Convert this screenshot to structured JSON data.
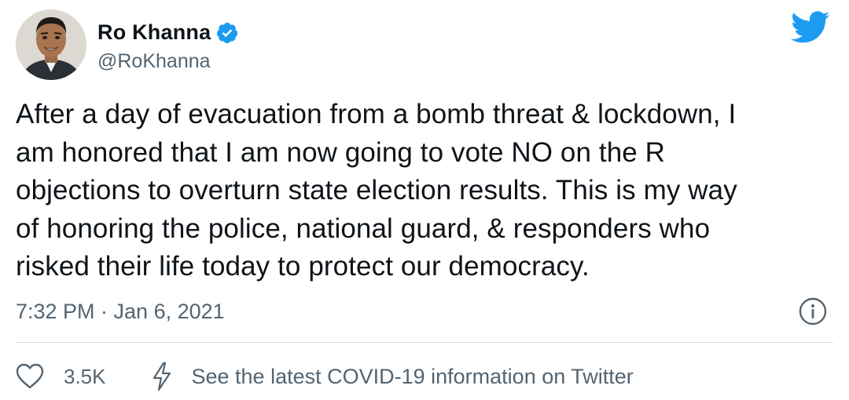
{
  "user": {
    "display_name": "Ro Khanna",
    "handle": "@RoKhanna",
    "verified": true,
    "avatar_icon": "profile-photo"
  },
  "tweet": {
    "text_lines": [
      "After a day of evacuation from a bomb threat & lockdown, I",
      "am honored that I am now going to vote NO on the R",
      "objections to overturn state election results. This is my way",
      "of honoring the police, national guard, & responders who",
      "risked their life today to protect our democracy."
    ],
    "timestamp": "7:32 PM · Jan 6, 2021"
  },
  "actions": {
    "like_count": "3.5K",
    "covid_link": "See the latest COVID-19 information on Twitter"
  },
  "icons": {
    "logo": "twitter-bird-icon",
    "verified": "verified-badge-icon",
    "info": "info-icon",
    "like": "heart-icon",
    "covid": "lightning-bolt-icon"
  },
  "colors": {
    "brand_blue": "#1d9bf0",
    "text_primary": "#0f1419",
    "text_secondary": "#536471",
    "divider": "#d6dbdf"
  }
}
